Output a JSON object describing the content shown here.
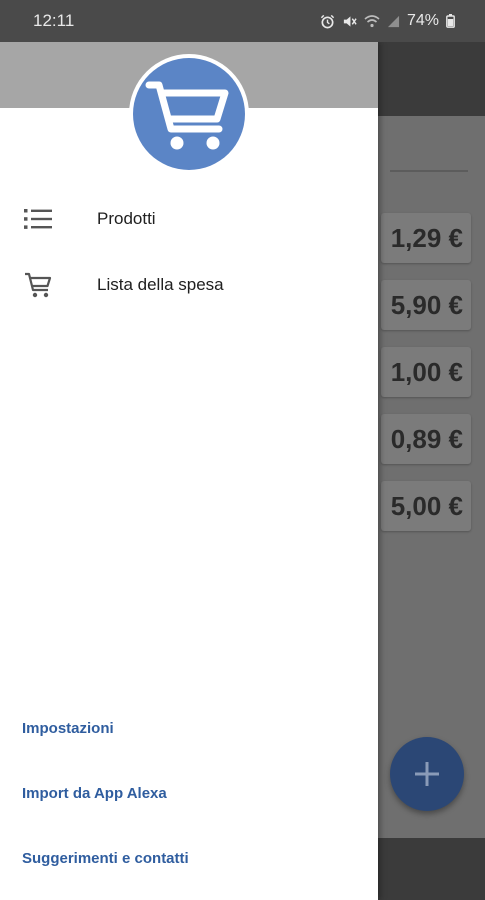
{
  "status_bar": {
    "time": "12:11",
    "battery": "74%",
    "icons": [
      "alarm-icon",
      "mute-icon",
      "wifi-icon",
      "signal-icon",
      "battery-icon"
    ]
  },
  "drawer": {
    "logo_icon": "shopping-cart-icon",
    "colors": {
      "logo_bg": "#5b85c6",
      "header_bg": "#a6a6a6",
      "link": "#2f5d9f"
    },
    "menu": [
      {
        "label": "Prodotti",
        "icon": "list-icon"
      },
      {
        "label": "Lista della spesa",
        "icon": "cart-icon"
      }
    ],
    "footer_links": [
      {
        "label": "Impostazioni"
      },
      {
        "label": "Import da App Alexa"
      },
      {
        "label": "Suggerimenti e contatti"
      }
    ]
  },
  "background": {
    "prices": [
      "1,29 €",
      "5,90 €",
      "1,00 €",
      "0,89 €",
      "5,00 €"
    ],
    "fab_icon": "plus-icon",
    "colors": {
      "fab": "#2b4775"
    }
  }
}
